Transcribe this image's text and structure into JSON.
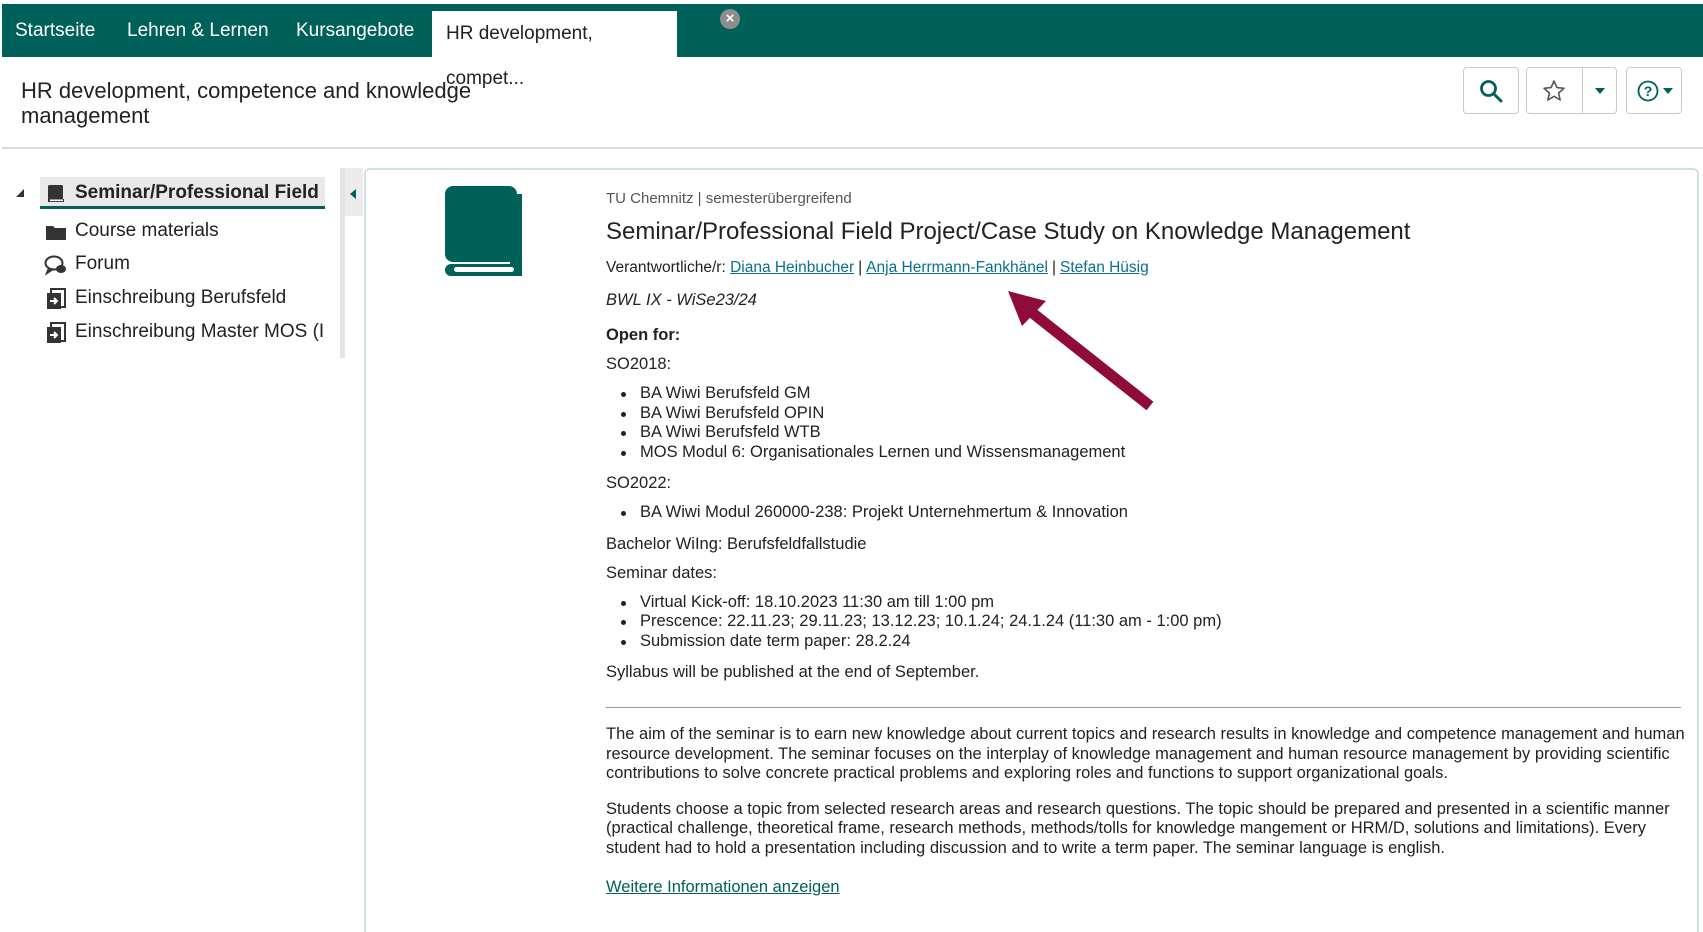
{
  "nav": {
    "tabs": [
      {
        "label": "Startseite"
      },
      {
        "label": "Lehren & Lernen"
      },
      {
        "label": "Kursangebote"
      },
      {
        "label": "HR development, compet..."
      }
    ],
    "close_icon": "close-icon"
  },
  "header": {
    "title": "HR development, competence and knowledge management"
  },
  "tree": {
    "items": [
      {
        "label": "Seminar/Professional Field",
        "icon": "book-icon"
      },
      {
        "label": "Course materials",
        "icon": "folder-icon"
      },
      {
        "label": "Forum",
        "icon": "forum-icon"
      },
      {
        "label": "Einschreibung Berufsfeld",
        "icon": "enrollment-icon"
      },
      {
        "label": "Einschreibung Master MOS (I",
        "icon": "enrollment-icon"
      }
    ]
  },
  "course": {
    "meta": "TU Chemnitz | semesterübergreifend",
    "title": "Seminar/Professional Field Project/Case Study on Knowledge Management",
    "responsible_label": "Verantwortliche/r:",
    "responsible": [
      "Diana Heinbucher",
      "Anja Herrmann-Fankhänel",
      "Stefan Hüsig"
    ],
    "semester": "BWL IX - WiSe23/24",
    "open_for": "Open for:",
    "so2018_label": "SO2018:",
    "so2018": [
      "BA Wiwi Berufsfeld GM",
      "BA Wiwi Berufsfeld OPIN",
      "BA Wiwi Berufsfeld WTB",
      "MOS Modul 6: Organisationales Lernen und Wissensmanagement"
    ],
    "so2022_label": "SO2022:",
    "so2022": [
      "BA Wiwi Modul 260000-238: Projekt Unternehmertum & Innovation"
    ],
    "bachelor": "Bachelor WiIng: Berufsfeldfallstudie",
    "dates_label": "Seminar dates:",
    "dates": [
      "Virtual Kick-off: 18.10.2023 11:30 am till 1:00 pm",
      "Prescence: 22.11.23; 29.11.23; 13.12.23; 10.1.24; 24.1.24 (11:30 am - 1:00 pm)",
      "Submission date term paper: 28.2.24"
    ],
    "syllabus": "Syllabus will be published at the end of September.",
    "description_1": "The aim of the seminar is to earn new knowledge about current topics and research results in knowledge and competence management and human resource development. The seminar focuses on the interplay of knowledge management and human resource management by providing scientific contributions to solve concrete practical problems and exploring roles and functions to support organizational goals.",
    "description_2": "Students choose a topic from selected research areas and research questions. The topic should be prepared and presented in a scientific manner (practical challenge, theoretical frame, research methods, methods/tolls for knowledge mangement or HRM/D, solutions and limitations). Every student had to hold a presentation including discussion and to write a term paper. The seminar language is english.",
    "more_link": "Weitere Informationen anzeigen"
  },
  "colors": {
    "brand": "#00605a",
    "link": "#0b6f8d",
    "annotation_arrow": "#8e0b3a"
  }
}
